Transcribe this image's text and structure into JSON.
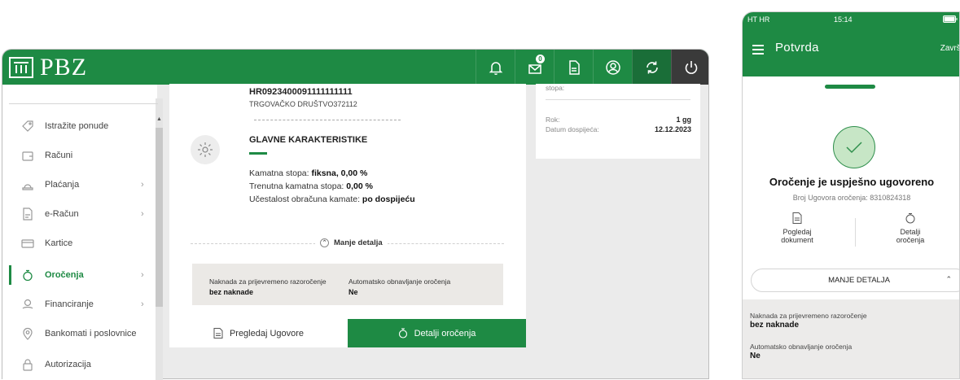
{
  "desktop": {
    "logo_text": "PBZ",
    "header_icons": [
      "bell-icon",
      "mail-icon",
      "document-icon",
      "user-icon",
      "refresh-icon",
      "power-icon"
    ],
    "mail_badge": "0",
    "sidebar": {
      "items": [
        {
          "label": "Istražite ponude",
          "icon": "tag-icon",
          "chevron": ""
        },
        {
          "label": "Računi",
          "icon": "wallet-icon",
          "chevron": ""
        },
        {
          "label": "Plaćanja",
          "icon": "payment-icon",
          "chevron": "›"
        },
        {
          "label": "e-Račun",
          "icon": "e-invoice-icon",
          "chevron": "›"
        },
        {
          "label": "Kartice",
          "icon": "card-icon",
          "chevron": ""
        },
        {
          "label": "Oročenja",
          "icon": "deposit-icon",
          "chevron": "›"
        },
        {
          "label": "Financiranje",
          "icon": "financing-icon",
          "chevron": "›"
        },
        {
          "label": "Bankomati i poslovnice",
          "icon": "location-icon",
          "chevron": ""
        },
        {
          "label": "Autorizacija",
          "icon": "lock-icon",
          "chevron": ""
        }
      ],
      "scroll_up": "▲"
    },
    "account": {
      "iban": "HR0923400091111111111",
      "holder": "TRGOVAČKO DRUŠTVO372112"
    },
    "characteristics": {
      "title": "GLAVNE KARAKTERISTIKE",
      "rows": [
        {
          "key": "Kamatna stopa:",
          "value": "fiksna, 0,00 %"
        },
        {
          "key": "Trenutna kamatna stopa:",
          "value": "0,00 %"
        },
        {
          "key": "Učestalost obračuna kamate:",
          "value": "po dospijeću"
        }
      ]
    },
    "less_details": "Manje detalja",
    "less_details_icon": "⌃",
    "details_box": {
      "early_key": "Naknada za prijevremeno razoročenje",
      "early_value": "bez naknade",
      "auto_key": "Automatsko obnavljanje oročenja",
      "auto_value": "Ne"
    },
    "buttons": {
      "review": "Pregledaj Ugovore",
      "details": "Detalji oročenja"
    },
    "summary": {
      "top_label": "stopa:",
      "term_key": "Rok:",
      "term_value": "1 gg",
      "maturity_key": "Datum dospijeća:",
      "maturity_value": "12.12.2023"
    }
  },
  "phone": {
    "status": {
      "carrier": "HT HR",
      "time": "15:14"
    },
    "title": "Potvrda",
    "done": "Završi",
    "heading": "Oročenje je uspješno ugovoreno",
    "contract_number": "Broj Ugovora oročenja: 8310824318",
    "actions": {
      "view_doc_1": "Pogledaj",
      "view_doc_2": "dokument",
      "details_1": "Detalji",
      "details_2": "oročenja"
    },
    "less_details": "MANJE DETALJA",
    "less_chevron": "⌃",
    "box": {
      "early_key": "Naknada za prijevremeno razoročenje",
      "early_value": "bez naknade",
      "auto_key": "Automatsko obnavljanje oročenja",
      "auto_value": "Ne"
    }
  },
  "colors": {
    "brand_green": "#1e8a44",
    "dark_green": "#1a6e38",
    "dark_grey": "#3a3a3a"
  }
}
